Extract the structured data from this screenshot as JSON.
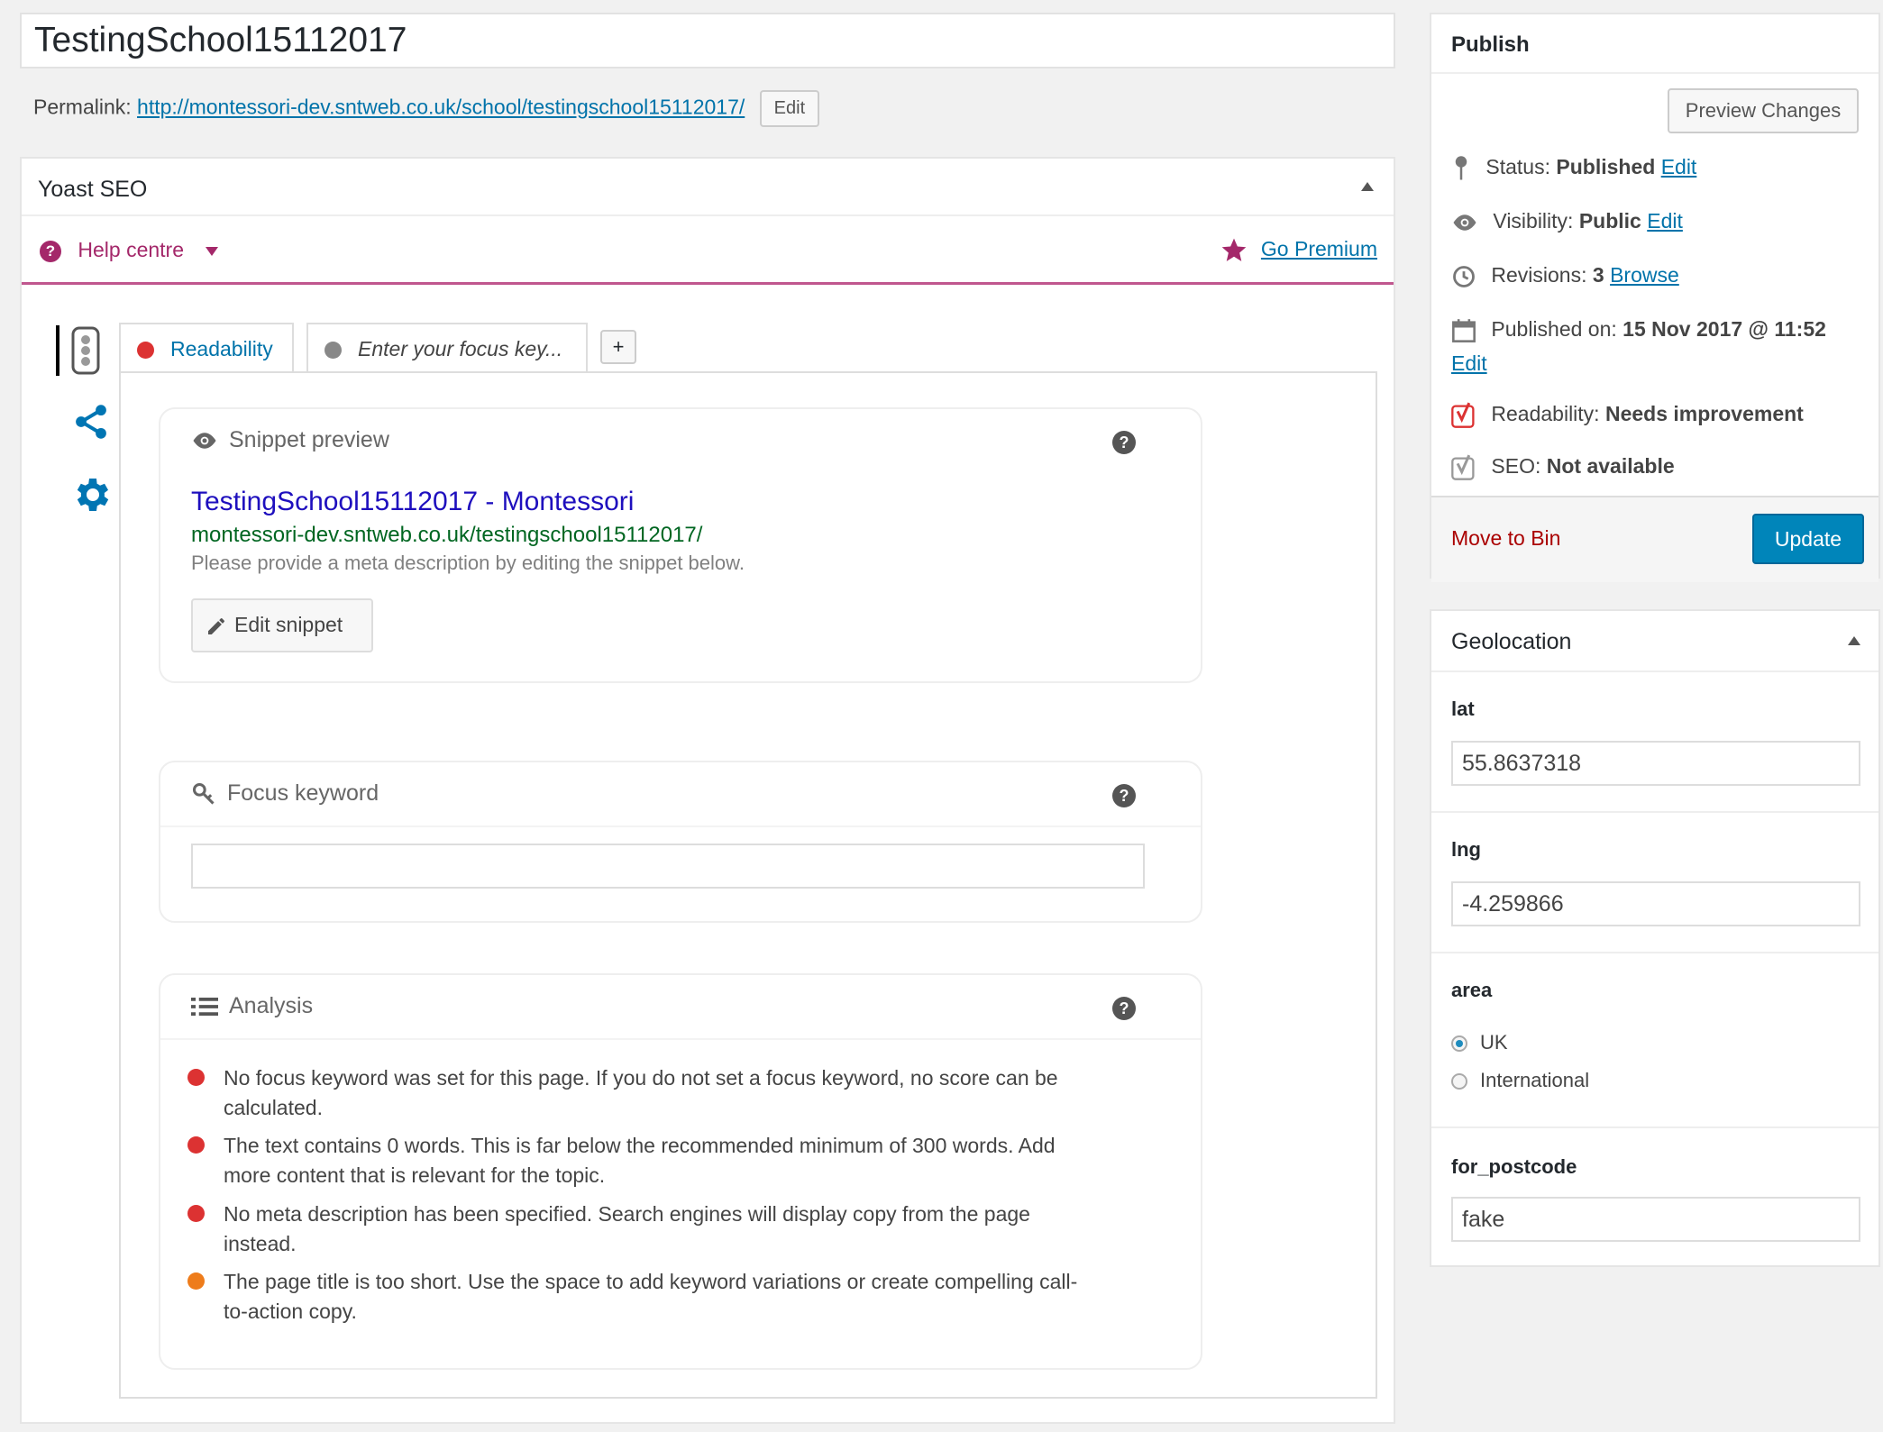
{
  "post": {
    "title": "TestingSchool15112017",
    "permalink_label": "Permalink:",
    "permalink_url": "http://montessori-dev.sntweb.co.uk/school/testingschool15112017/",
    "permalink_edit": "Edit"
  },
  "yoast": {
    "title": "Yoast SEO",
    "help_centre": "Help centre",
    "go_premium": "Go Premium",
    "tabs": {
      "readability": "Readability",
      "focus_placeholder": "Enter your focus key...",
      "add": "+"
    },
    "snippet": {
      "header": "Snippet preview",
      "title": "TestingSchool15112017 - Montessori",
      "url": "montessori-dev.sntweb.co.uk/testingschool15112017/",
      "description": "Please provide a meta description by editing the snippet below.",
      "edit_button": "Edit snippet"
    },
    "focus": {
      "header": "Focus keyword",
      "value": ""
    },
    "analysis": {
      "header": "Analysis",
      "items": [
        {
          "status": "red",
          "text": "No focus keyword was set for this page. If you do not set a focus keyword, no score can be calculated."
        },
        {
          "status": "red",
          "text": "The text contains 0 words. This is far below the recommended minimum of 300 words. Add more content that is relevant for the topic."
        },
        {
          "status": "red",
          "text": "No meta description has been specified. Search engines will display copy from the page instead."
        },
        {
          "status": "orange",
          "text": "The page title is too short. Use the space to add keyword variations or create compelling call-to-action copy."
        }
      ]
    }
  },
  "publish": {
    "title": "Publish",
    "preview_changes": "Preview Changes",
    "status_label": "Status:",
    "status_value": "Published",
    "visibility_label": "Visibility:",
    "visibility_value": "Public",
    "revisions_label": "Revisions:",
    "revisions_value": "3",
    "browse": "Browse",
    "published_on_label": "Published on:",
    "published_on_value": "15 Nov 2017 @ 11:52",
    "edit": "Edit",
    "readability_label": "Readability:",
    "readability_value": "Needs improvement",
    "seo_label": "SEO:",
    "seo_value": "Not available",
    "move_to_bin": "Move to Bin",
    "update": "Update"
  },
  "geolocation": {
    "title": "Geolocation",
    "lat_label": "lat",
    "lat_value": "55.8637318",
    "lng_label": "lng",
    "lng_value": "-4.259866",
    "area_label": "area",
    "area_options": [
      "UK",
      "International"
    ],
    "area_selected": "UK",
    "postcode_label": "for_postcode",
    "postcode_value": "fake"
  },
  "colors": {
    "accent": "#0073aa",
    "yoast_purple": "#a4286a",
    "error_red": "#dc3232",
    "warning_orange": "#ee7c1b",
    "snippet_title": "#1e0fbe",
    "snippet_url": "#006621",
    "icon_blue": "#0075b3"
  }
}
